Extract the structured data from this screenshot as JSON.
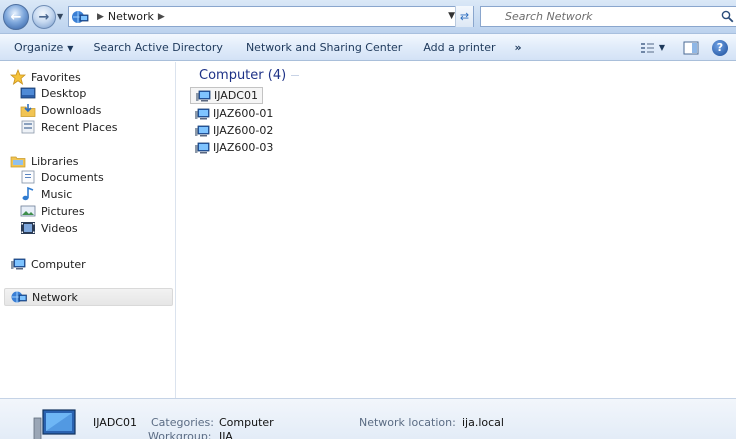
{
  "window": {
    "title": "Network"
  },
  "address_bar": {
    "breadcrumb": [
      "Network"
    ],
    "search_placeholder": "Search Network",
    "icons": {
      "back": "back-arrow-icon",
      "forward": "forward-arrow-icon",
      "refresh": "refresh-icon",
      "search": "search-icon"
    }
  },
  "toolbar": {
    "organize": "Organize",
    "search_ad": "Search Active Directory",
    "net_sharing": "Network and Sharing Center",
    "add_printer": "Add a printer",
    "more": "»"
  },
  "sidebar": {
    "favorites": {
      "label": "Favorites",
      "icon": "star-icon"
    },
    "favorites_items": [
      {
        "label": "Desktop",
        "icon": "desktop-icon"
      },
      {
        "label": "Downloads",
        "icon": "downloads-icon"
      },
      {
        "label": "Recent Places",
        "icon": "recent-places-icon"
      }
    ],
    "libraries": {
      "label": "Libraries",
      "icon": "libraries-icon"
    },
    "libraries_items": [
      {
        "label": "Documents",
        "icon": "documents-icon"
      },
      {
        "label": "Music",
        "icon": "music-icon"
      },
      {
        "label": "Pictures",
        "icon": "pictures-icon"
      },
      {
        "label": "Videos",
        "icon": "videos-icon"
      }
    ],
    "computer": {
      "label": "Computer",
      "icon": "computer-icon"
    },
    "network": {
      "label": "Network",
      "icon": "network-icon",
      "selected": true
    }
  },
  "main": {
    "group_title": "Computer (4)",
    "items": [
      {
        "name": "IJADC01",
        "focused": true
      },
      {
        "name": "IJAZ600-01"
      },
      {
        "name": "IJAZ600-02"
      },
      {
        "name": "IJAZ600-03"
      }
    ]
  },
  "details": {
    "name": "IJADC01",
    "categories_label": "Categories:",
    "categories_value": "Computer",
    "workgroup_label": "Workgroup:",
    "workgroup_value": "IJA",
    "location_label": "Network location:",
    "location_value": "ija.local"
  }
}
